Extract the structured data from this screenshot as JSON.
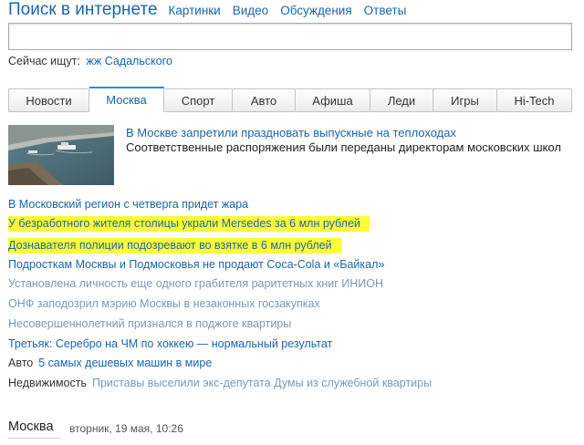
{
  "header": {
    "title": "Поиск в интернете",
    "links": [
      "Картинки",
      "Видео",
      "Обсуждения",
      "Ответы"
    ]
  },
  "search": {
    "value": "",
    "placeholder": ""
  },
  "trending": {
    "label": "Сейчас ищут:",
    "query": "жж Садальского"
  },
  "tabs": [
    {
      "label": "Новости"
    },
    {
      "label": "Москва"
    },
    {
      "label": "Спорт"
    },
    {
      "label": "Авто"
    },
    {
      "label": "Афиша"
    },
    {
      "label": "Леди"
    },
    {
      "label": "Игры"
    },
    {
      "label": "Hi-Tech"
    }
  ],
  "active_tab": "Москва",
  "lead": {
    "title": "В Москве запретили праздновать выпускные на теплоходах",
    "description": "Соответственные распоряжения были переданы директорам московских школ"
  },
  "news": [
    {
      "text": "В Московский регион с четверга придет жара"
    },
    {
      "text": "У безработного жителя столицы украли Mersedes за 6 млн рублей"
    },
    {
      "text": "Дознавателя полиции подозревают во взятке в 6 млн рублей"
    },
    {
      "text": "Подросткам Москвы и Подмосковья не продают Coca-Cola и «Байкал»"
    },
    {
      "text": "Установлена личность еще одного грабителя раритетных книг ИНИОН"
    },
    {
      "text": "ОНФ заподозрил мэрию Москвы в незаконных госзакупках"
    },
    {
      "text": "Несовершеннолетний признался в поджоге квартиры"
    },
    {
      "text": "Третьяк: Серебро на ЧМ по хоккею — нормальный результат"
    },
    {
      "category": "Авто",
      "text": "5 самых дешевых машин в мире"
    },
    {
      "category": "Недвижимость",
      "text": "Приставы выселили экс-депутата Думы из служебной квартиры"
    }
  ],
  "footer": {
    "city": "Москва",
    "date": "вторник, 19 мая, 10:26"
  },
  "colors": {
    "link": "#1a64ad",
    "visited": "#7b98b4",
    "highlight": "#ffff33",
    "tab_accent": "#2e8ad8"
  }
}
